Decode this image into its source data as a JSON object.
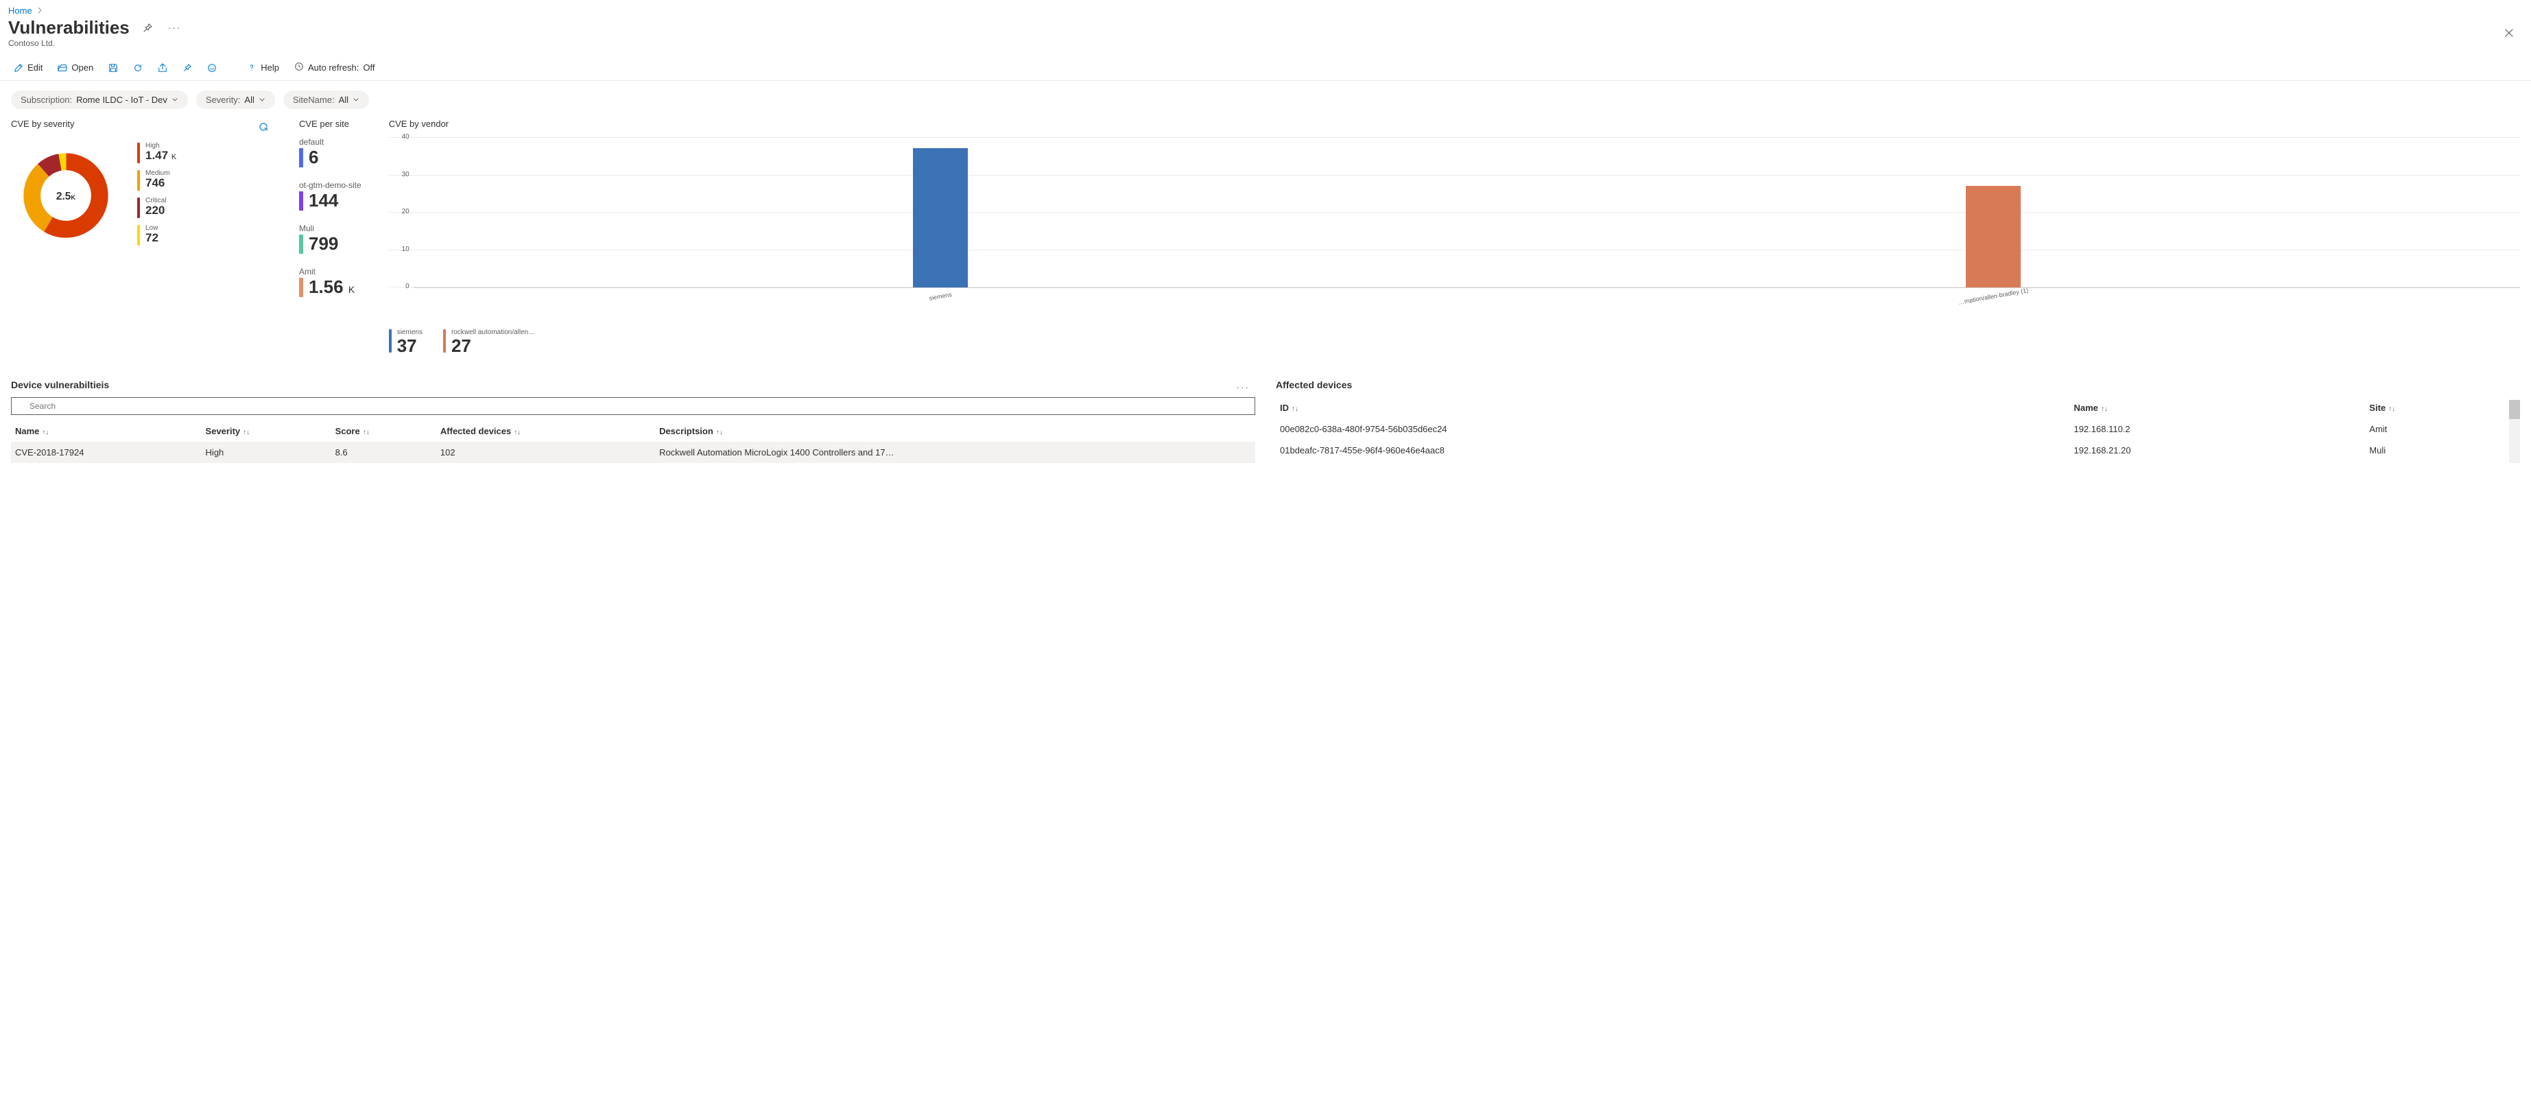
{
  "breadcrumb": {
    "home": "Home"
  },
  "title": "Vulnerabilities",
  "subtitle": "Contoso Ltd.",
  "commands": {
    "edit": "Edit",
    "open": "Open",
    "help": "Help",
    "auto_refresh_label": "Auto refresh:",
    "auto_refresh_state": "Off"
  },
  "filters": {
    "subscription": {
      "label": "Subscription:",
      "value": "Rome ILDC - IoT - Dev"
    },
    "severity": {
      "label": "Severity:",
      "value": "All"
    },
    "sitename": {
      "label": "SiteName:",
      "value": "All"
    }
  },
  "tiles": {
    "cve_severity": {
      "title": "CVE by severity",
      "total_display": "2.5",
      "total_unit": "K",
      "items": [
        {
          "label": "High",
          "display": "1.47",
          "unit": "K",
          "color": "#da3b01",
          "value": 1470
        },
        {
          "label": "Medium",
          "display": "746",
          "unit": "",
          "color": "#f2a100",
          "value": 746
        },
        {
          "label": "Critical",
          "display": "220",
          "unit": "",
          "color": "#a4262c",
          "value": 220
        },
        {
          "label": "Low",
          "display": "72",
          "unit": "",
          "color": "#ffd700",
          "value": 72
        }
      ]
    },
    "cve_per_site": {
      "title": "CVE per site",
      "items": [
        {
          "name": "default",
          "display": "6",
          "unit": "",
          "color": "#4f6bed"
        },
        {
          "name": "ot-gtm-demo-site",
          "display": "144",
          "unit": "",
          "color": "#7e3ff2"
        },
        {
          "name": "Muli",
          "display": "799",
          "unit": "",
          "color": "#57c7a2"
        },
        {
          "name": "Amit",
          "display": "1.56",
          "unit": "K",
          "color": "#e58f65"
        }
      ]
    },
    "cve_vendor": {
      "title": "CVE by vendor",
      "legend": [
        {
          "name": "siemens",
          "display": "37",
          "color": "#3a72b5"
        },
        {
          "name": "rockwell automation/allen…",
          "display": "27",
          "color": "#d97a57"
        }
      ]
    }
  },
  "chart_data": {
    "type": "bar",
    "categories": [
      "siemens",
      "…mation/allen-bradley (1)"
    ],
    "series": [
      {
        "name": "siemens",
        "values": [
          37,
          null
        ],
        "color": "#3a72b5"
      },
      {
        "name": "rockwell automation/allen-bradley",
        "values": [
          null,
          27
        ],
        "color": "#d97a57"
      }
    ],
    "ylim": [
      0,
      40
    ],
    "yticks": [
      0,
      10,
      20,
      30,
      40
    ],
    "title": "CVE by vendor"
  },
  "device_vuln": {
    "title": "Device vulnerabiltieis",
    "search_placeholder": "Search",
    "columns": [
      "Name",
      "Severity",
      "Score",
      "Affected devices",
      "Descriptsion"
    ],
    "rows": [
      {
        "name": "CVE-2018-17924",
        "severity": "High",
        "score": "8.6",
        "affected": "102",
        "desc": "Rockwell Automation MicroLogix 1400 Controllers and 17…"
      }
    ]
  },
  "affected_devices": {
    "title": "Affected devices",
    "columns": [
      "ID",
      "Name",
      "Site"
    ],
    "rows": [
      {
        "id": "00e082c0-638a-480f-9754-56b035d6ec24",
        "name": "192.168.110.2",
        "site": "Amit"
      },
      {
        "id": "01bdeafc-7817-455e-96f4-960e46e4aac8",
        "name": "192.168.21.20",
        "site": "Muli"
      }
    ]
  }
}
